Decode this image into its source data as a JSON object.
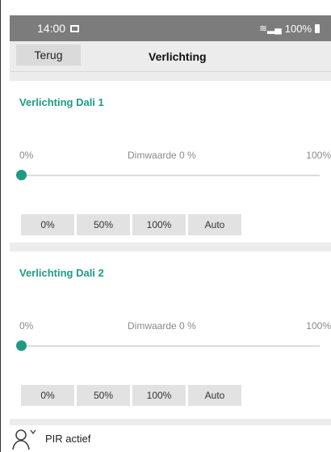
{
  "status_bar": {
    "time": "14:00",
    "battery": "100%"
  },
  "toolbar": {
    "back_label": "Terug",
    "title": "Verlichting"
  },
  "cards": [
    {
      "title": "Verlichting Dali 1",
      "range_min": "0%",
      "dim_label": "Dimwaarde 0 %",
      "range_max": "100%",
      "slider_value": 0,
      "buttons": [
        "0%",
        "50%",
        "100%",
        "Auto"
      ]
    },
    {
      "title": "Verlichting Dali 2",
      "range_min": "0%",
      "dim_label": "Dimwaarde 0 %",
      "range_max": "100%",
      "slider_value": 0,
      "buttons": [
        "0%",
        "50%",
        "100%",
        "Auto"
      ]
    }
  ],
  "pir": {
    "label": "PIR actief",
    "icon": "person-icon"
  },
  "colors": {
    "accent": "#1e9b86",
    "status_bar": "#7c7c7c",
    "toolbar": "#ececec"
  }
}
